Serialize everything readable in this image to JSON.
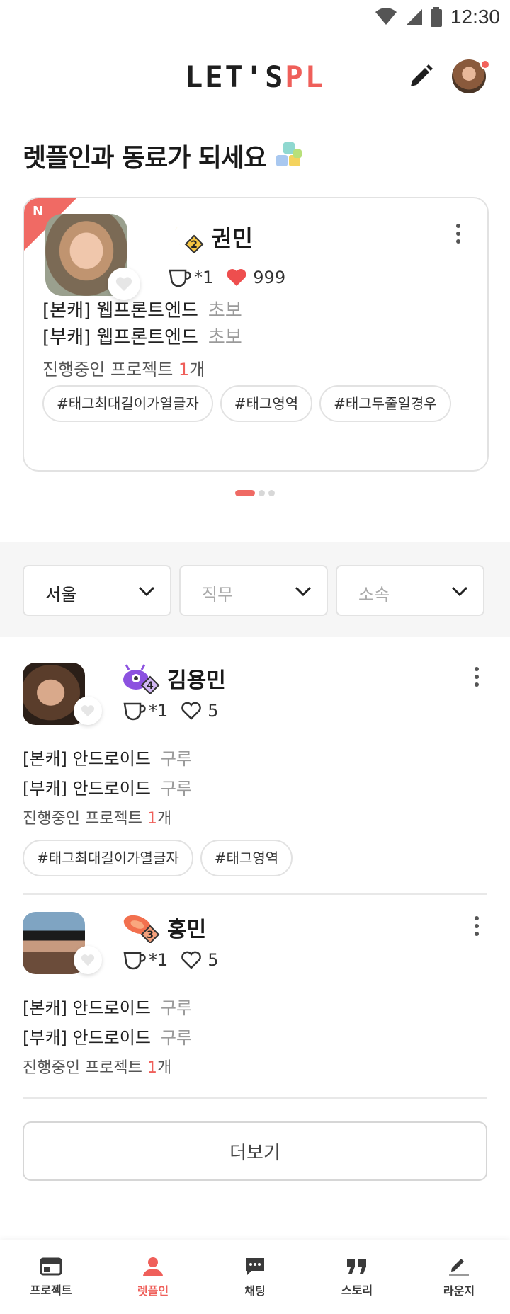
{
  "status_bar": {
    "time": "12:30"
  },
  "header": {
    "logo_part1": "LET'S",
    "logo_part2": "PL"
  },
  "section": {
    "title": "렛플인과 동료가 되세요"
  },
  "featured": {
    "new_badge": "N",
    "name": "권민",
    "level": "2",
    "coffee": "*1",
    "likes": "999",
    "main_role": "[본캐] 웹프론트엔드",
    "main_level": "초보",
    "sub_role": "[부캐] 웹프론트엔드",
    "sub_level": "초보",
    "project_prefix": "진행중인 프로젝트 ",
    "project_count": "1",
    "project_suffix": "개",
    "tags": [
      "#태그최대길이가열글자",
      "#태그영역",
      "#태그두줄일경우"
    ]
  },
  "filters": [
    {
      "value": "서울",
      "is_placeholder": false
    },
    {
      "value": "직무",
      "is_placeholder": true
    },
    {
      "value": "소속",
      "is_placeholder": true
    }
  ],
  "list": [
    {
      "name": "김용민",
      "level": "4",
      "coffee": "*1",
      "likes": "5",
      "main_role": "[본캐] 안드로이드",
      "main_level": "구루",
      "sub_role": "[부캐] 안드로이드",
      "sub_level": "구루",
      "project_prefix": "진행중인 프로젝트 ",
      "project_count": "1",
      "project_suffix": "개",
      "tags": [
        "#태그최대길이가열글자",
        "#태그영역"
      ]
    },
    {
      "name": "홍민",
      "level": "3",
      "coffee": "*1",
      "likes": "5",
      "main_role": "[본캐] 안드로이드",
      "main_level": "구루",
      "sub_role": "[부캐] 안드로이드",
      "sub_level": "구루",
      "project_prefix": "진행중인 프로젝트 ",
      "project_count": "1",
      "project_suffix": "개",
      "tags": []
    }
  ],
  "more_button": "더보기",
  "bottom_nav": [
    {
      "label": "프로젝트",
      "icon": "project-board-icon",
      "active": false
    },
    {
      "label": "렛플인",
      "icon": "person-icon",
      "active": true
    },
    {
      "label": "채팅",
      "icon": "chat-icon",
      "active": false
    },
    {
      "label": "스토리",
      "icon": "quote-icon",
      "active": false
    },
    {
      "label": "라운지",
      "icon": "pen-icon",
      "active": false
    }
  ],
  "colors": {
    "accent": "#ef5f5a",
    "border": "#e2e2e2",
    "filter_bg": "#f6f6f6"
  }
}
